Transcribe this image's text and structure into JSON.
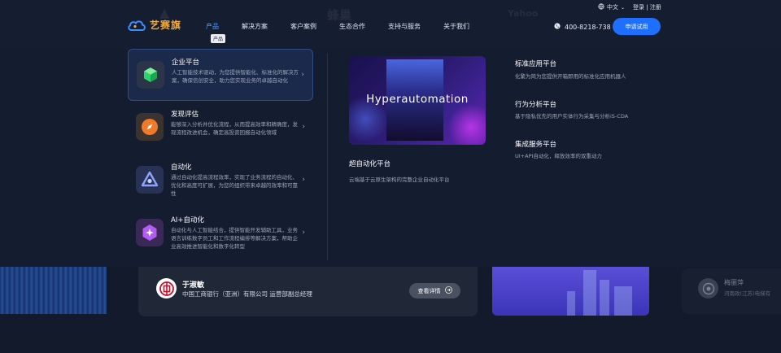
{
  "header": {
    "brand": "艺赛旗",
    "nav": [
      "产品",
      "解决方案",
      "客户案例",
      "生态合作",
      "支持与服务",
      "关于我们"
    ],
    "nav_tip": "产品",
    "lang": "中文",
    "login": "登录 | 注册",
    "phone": "400-8218-738",
    "apply_label": "申请试用",
    "ghost_logos": [
      "蜂巢",
      "Yahoo"
    ]
  },
  "products": [
    {
      "title": "企业平台",
      "desc": "人工智能技术驱动，为您提供智能化、标准化的解决方案，确保信创安全，助力您实现业务的卓越自动化"
    },
    {
      "title": "发现评估",
      "desc": "能够深入分析并优化流程，从而提高效率和精确度，发现流程改进机会，确定高投资回报自动化领域"
    },
    {
      "title": "自动化",
      "desc": "通过自动化提高流程效率，实现了业务流程的自动化、优化和高度可扩展，为您的组织带来卓越的效率和可靠性"
    },
    {
      "title": "AI+自动化",
      "desc": "自动化与人工智能结合，提供智能开发辅助工具，业务语言训练数字员工和工作流程编排等解决方案，帮助企业高效推进智能化和数字化转型"
    }
  ],
  "hero": {
    "image_text": "Hyperautomation",
    "title": "超自动化平台",
    "desc": "云端基于云原生架构的完整企业自动化平台"
  },
  "platforms": [
    {
      "title": "标准应用平台",
      "desc": "化繁为简为您提供开箱即用的标准化应用机器人"
    },
    {
      "title": "行为分析平台",
      "desc": "基于隐私优先的用户实体行为采集与分析iS-CDA"
    },
    {
      "title": "集成服务平台",
      "desc": "UI+API自动化，释放效率的双重动力"
    }
  ],
  "testimonial": {
    "name": "于淑敏",
    "role": "中国工商银行（亚洲）有限公司 运营部副总经理",
    "button": "查看详情"
  },
  "ghost_testimonial": {
    "name": "梅丽萍",
    "role": "河南政(江苏)电梯有"
  },
  "colors": {
    "accent": "#1f6fff",
    "nav_active": "#4d9bff",
    "brand": "#f2a93b",
    "background": "#121a2c"
  }
}
